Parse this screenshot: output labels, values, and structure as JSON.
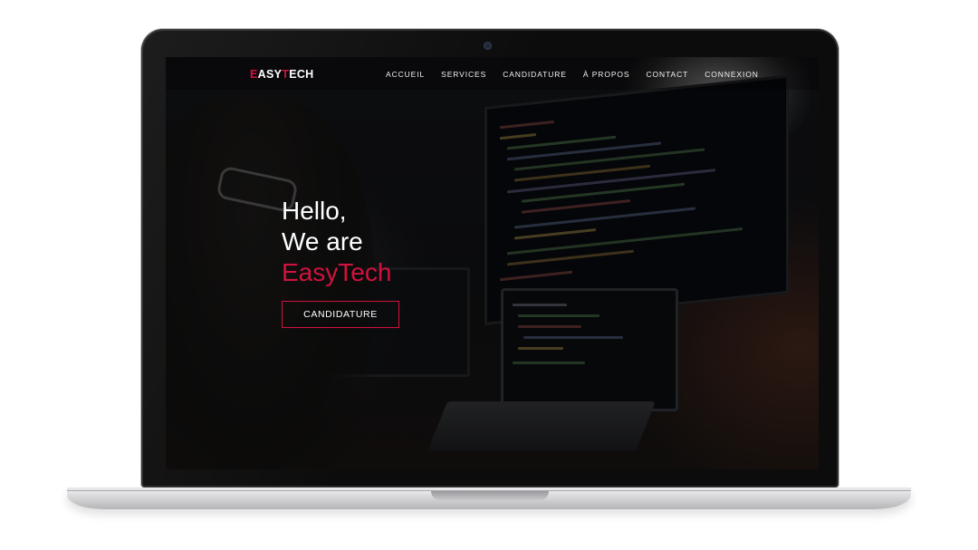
{
  "nav": {
    "logo": {
      "first": "E",
      "mid": "ASY",
      "second": "T",
      "last": "ECH"
    },
    "items": [
      "ACCUEIL",
      "SERVICES",
      "CANDIDATURE",
      "À PROPOS",
      "CONTACT",
      "CONNEXION"
    ]
  },
  "hero": {
    "line1": "Hello,",
    "line2": "We are",
    "brand": "EasyTech",
    "button": "CANDIDATURE"
  },
  "colors": {
    "accent": "#d0123e",
    "text": "#ffffff"
  }
}
